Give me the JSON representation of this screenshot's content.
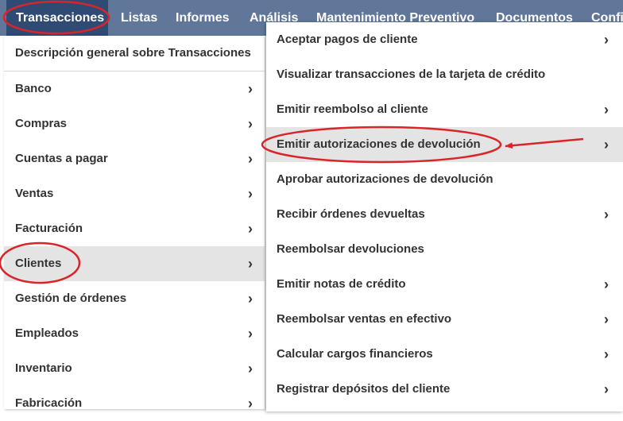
{
  "topbar": {
    "items": [
      {
        "label": "Transacciones",
        "active": true
      },
      {
        "label": "Listas"
      },
      {
        "label": "Informes"
      },
      {
        "label": "Análisis"
      },
      {
        "label": "Mantenimiento Preventivo"
      },
      {
        "label": "Documentos"
      },
      {
        "label": "Confi"
      }
    ]
  },
  "left_menu": {
    "overview": "Descripción general sobre Transacciones",
    "items": [
      {
        "label": "Banco"
      },
      {
        "label": "Compras"
      },
      {
        "label": "Cuentas a pagar"
      },
      {
        "label": "Ventas"
      },
      {
        "label": "Facturación"
      },
      {
        "label": "Clientes",
        "selected": true
      },
      {
        "label": "Gestión de órdenes"
      },
      {
        "label": "Empleados"
      },
      {
        "label": "Inventario"
      },
      {
        "label": "Fabricación"
      }
    ],
    "submenu_glyph": "›"
  },
  "right_menu": {
    "items": [
      {
        "label": "Aceptar pagos de cliente",
        "submenu": true
      },
      {
        "label": "Visualizar transacciones de la tarjeta de crédito",
        "submenu": false
      },
      {
        "label": "Emitir reembolso al cliente",
        "submenu": true
      },
      {
        "label": "Emitir autorizaciones de devolución",
        "submenu": true,
        "highlighted": true
      },
      {
        "label": "Aprobar autorizaciones de devolución",
        "submenu": false
      },
      {
        "label": "Recibir órdenes devueltas",
        "submenu": true
      },
      {
        "label": "Reembolsar devoluciones",
        "submenu": false
      },
      {
        "label": "Emitir notas de crédito",
        "submenu": true
      },
      {
        "label": "Reembolsar ventas en efectivo",
        "submenu": true
      },
      {
        "label": "Calcular cargos financieros",
        "submenu": true
      },
      {
        "label": "Registrar depósitos del cliente",
        "submenu": true
      }
    ]
  },
  "colors": {
    "topbar": "#607799",
    "topbar_active": "#2f4a73",
    "highlight": "#e4e4e4",
    "annotation": "#d9252a"
  }
}
